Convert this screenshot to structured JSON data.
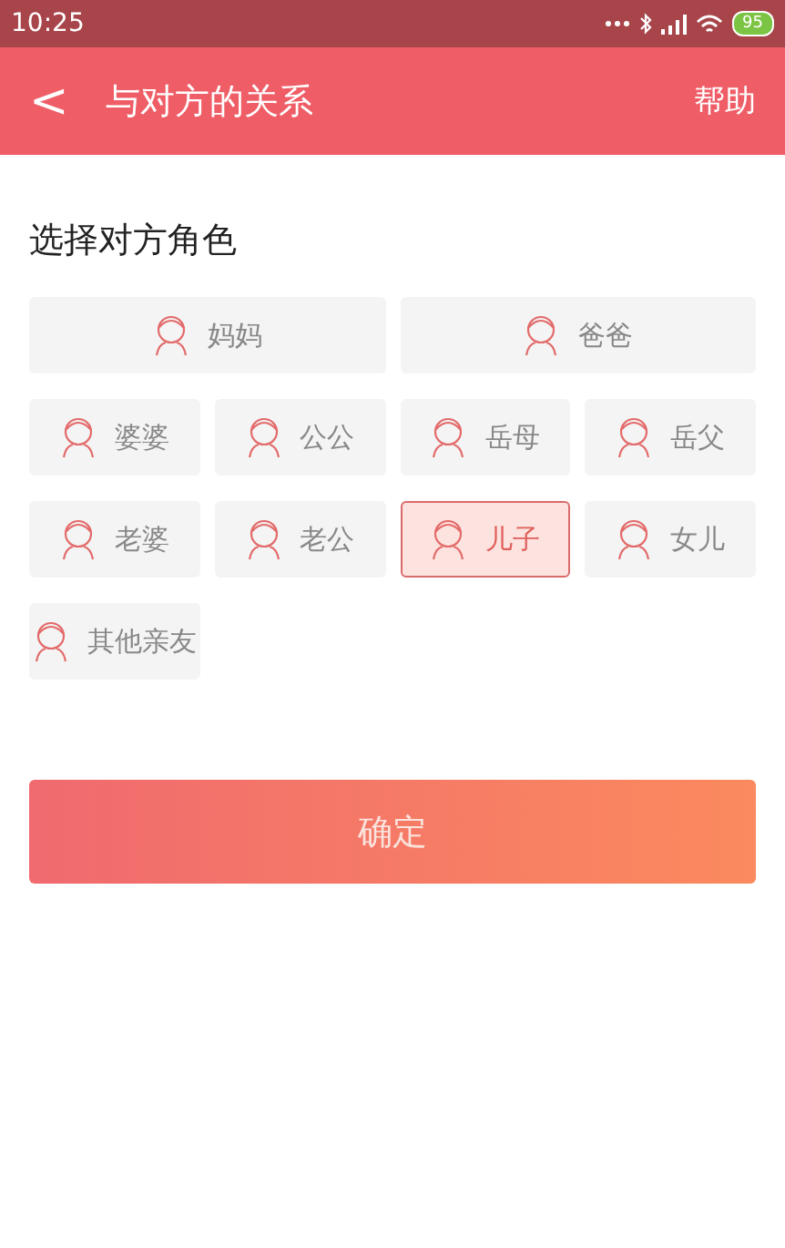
{
  "status_bar": {
    "time": "10:25",
    "battery": "95"
  },
  "header": {
    "back": "<",
    "title": "与对方的关系",
    "help": "帮助"
  },
  "section_title": "选择对方角色",
  "role_rows": [
    [
      {
        "label": "妈妈",
        "selected": false
      },
      {
        "label": "爸爸",
        "selected": false
      }
    ],
    [
      {
        "label": "婆婆",
        "selected": false
      },
      {
        "label": "公公",
        "selected": false
      },
      {
        "label": "岳母",
        "selected": false
      },
      {
        "label": "岳父",
        "selected": false
      }
    ],
    [
      {
        "label": "老婆",
        "selected": false
      },
      {
        "label": "老公",
        "selected": false
      },
      {
        "label": "儿子",
        "selected": true
      },
      {
        "label": "女儿",
        "selected": false
      }
    ],
    [
      {
        "label": "其他亲友",
        "selected": false
      }
    ]
  ],
  "confirm_button": "确定"
}
